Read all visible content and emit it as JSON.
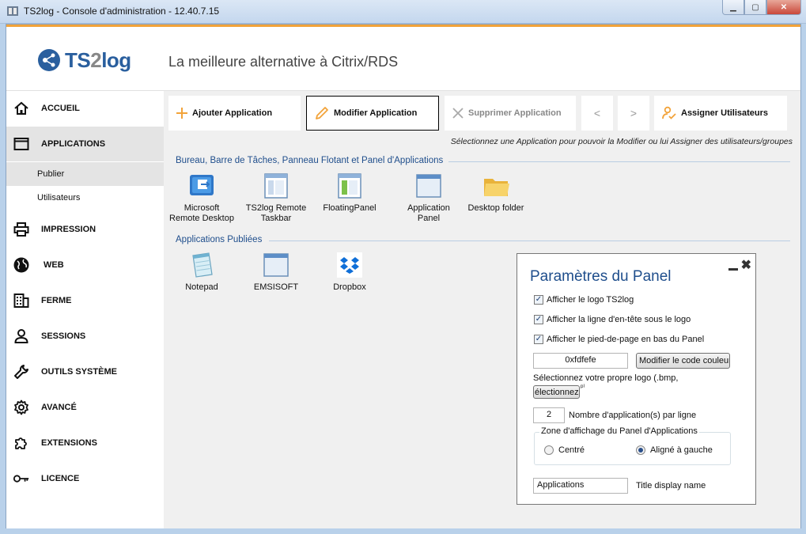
{
  "window": {
    "title": "TS2log - Console d'administration - 12.40.7.15",
    "minimize": "▁",
    "maximize": "▢",
    "close": "✕"
  },
  "header": {
    "logo_ts": "TS",
    "logo_two": "2",
    "logo_log": "log",
    "tagline": "La meilleure alternative à Citrix/RDS"
  },
  "sidebar": {
    "items": [
      {
        "label": "ACCUEIL",
        "icon": "home-icon"
      },
      {
        "label": "APPLICATIONS",
        "icon": "window-icon"
      },
      {
        "label": "IMPRESSION",
        "icon": "printer-icon"
      },
      {
        "label": "WEB",
        "icon": "globe-icon"
      },
      {
        "label": "FERME",
        "icon": "building-icon"
      },
      {
        "label": "SESSIONS",
        "icon": "user-icon"
      },
      {
        "label": "OUTILS SYSTÈME",
        "icon": "wrench-icon"
      },
      {
        "label": "AVANCÉ",
        "icon": "gear-icon"
      },
      {
        "label": "EXTENSIONS",
        "icon": "puzzle-icon"
      },
      {
        "label": "LICENCE",
        "icon": "key-icon"
      }
    ],
    "sub_items": [
      "Publier",
      "Utilisateurs"
    ]
  },
  "toolbar": {
    "add": "Ajouter Application",
    "edit": "Modifier Application",
    "delete": "Supprimer Application",
    "prev": "<",
    "next": ">",
    "assign": "Assigner Utilisateurs",
    "hint": "Sélectionnez une Application pour pouvoir la Modifier ou lui Assigner des utilisateurs/groupes"
  },
  "sections": {
    "desktop_title": "Bureau, Barre de Tâches, Panneau Flotant et Panel d'Applications",
    "published_title": "Applications Publiées"
  },
  "desktop_apps": [
    {
      "line1": "Microsoft",
      "line2": "Remote Desktop"
    },
    {
      "line1": "TS2log Remote",
      "line2": "Taskbar"
    },
    {
      "line1": "FloatingPanel",
      "line2": ""
    },
    {
      "line1": "Application",
      "line2": "Panel"
    },
    {
      "line1": "Desktop folder",
      "line2": ""
    }
  ],
  "published_apps": [
    {
      "label": "Notepad"
    },
    {
      "label": "EMSISOFT"
    },
    {
      "label": "Dropbox"
    }
  ],
  "panel": {
    "title": "Paramètres du Panel",
    "close": "✖",
    "check_logo": "Afficher le logo TS2log",
    "check_header_line": "Afficher la ligne d'en-tête sous le logo",
    "check_footer": "Afficher le pied-de-page en bas du Panel",
    "color_value": "0xfdfefe",
    "color_button": "Modifier le code couleur",
    "logo_label": "Sélectionnez votre propre logo (.bmp,",
    "logo_button": "électionnez",
    "logo_suffix": "ᵖ⁾",
    "apps_per_line_value": "2",
    "apps_per_line_label": "Nombre d'application(s) par ligne",
    "zone_legend": "Zone d'affichage du Panel d'Applications",
    "radio_center": "Centré",
    "radio_left": "Aligné à gauche",
    "title_display_value": "Applications",
    "title_display_label": "Title display name"
  },
  "colors": {
    "accent_orange": "#f2a33a",
    "section_blue": "#1f4e8c",
    "logo_blue": "#2a5f9e"
  }
}
